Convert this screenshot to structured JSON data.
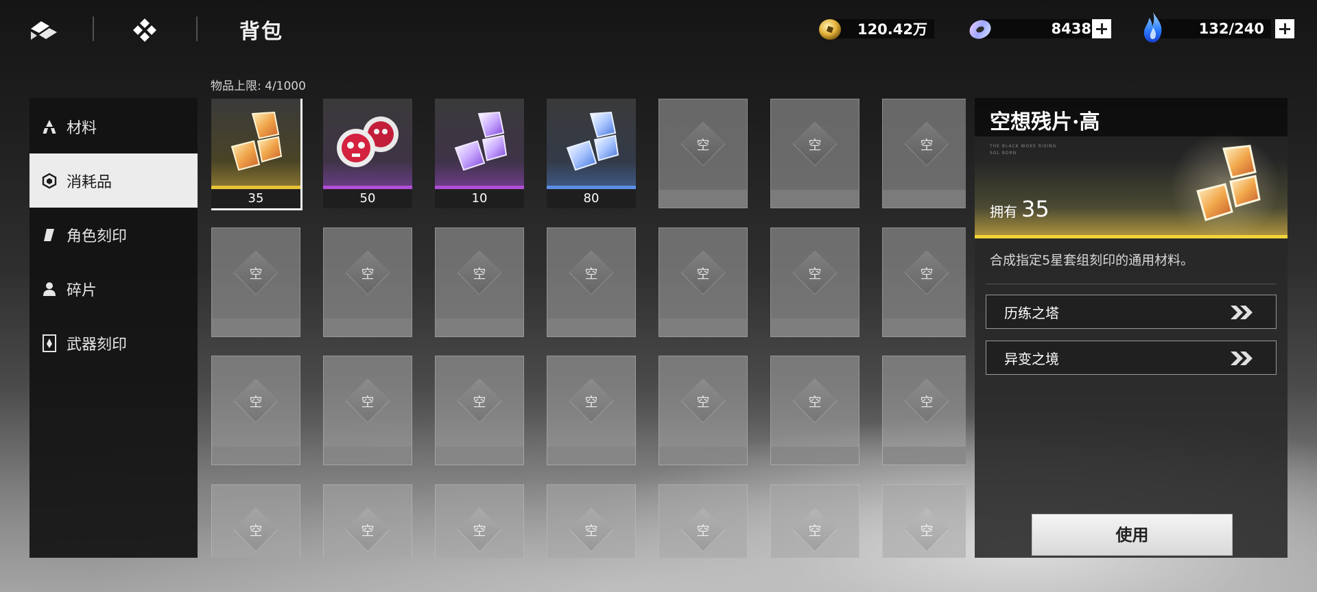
{
  "header": {
    "title": "背包",
    "back_icon": "back-chevron-icon",
    "home_icon": "home-diamond-icon"
  },
  "currencies": [
    {
      "name": "gold",
      "value": "120.42万",
      "icon": "gold-coin-icon",
      "has_plus": false
    },
    {
      "name": "crystal",
      "value": "8438",
      "icon": "crystal-ring-icon",
      "has_plus": true
    },
    {
      "name": "stamina",
      "value": "132/240",
      "icon": "blue-flame-icon",
      "has_plus": true
    }
  ],
  "sidebar": {
    "items": [
      {
        "label": "材料",
        "icon": "material-icon",
        "active": false
      },
      {
        "label": "消耗品",
        "icon": "consumable-icon",
        "active": true
      },
      {
        "label": "角色刻印",
        "icon": "character-imprint-icon",
        "active": false
      },
      {
        "label": "碎片",
        "icon": "fragment-person-icon",
        "active": false
      },
      {
        "label": "武器刻印",
        "icon": "weapon-imprint-icon",
        "active": false
      }
    ]
  },
  "inventory": {
    "capacity_label": "物品上限: 4/1000",
    "empty_label": "空",
    "items": [
      {
        "count": "35",
        "rarity_color": "#e8c33a",
        "art": "gold-fragment",
        "selected": true
      },
      {
        "count": "50",
        "rarity_color": "#b04ed6",
        "art": "red-skull-orbs",
        "selected": false
      },
      {
        "count": "10",
        "rarity_color": "#b04ed6",
        "art": "purple-fragment",
        "selected": false
      },
      {
        "count": "80",
        "rarity_color": "#5b8fe6",
        "art": "blue-fragment",
        "selected": false
      }
    ]
  },
  "detail": {
    "title": "空想残片·高",
    "tagline": "THE BLACK WOKE RISING\nSOL BORN",
    "own_label": "拥有",
    "own_value": "35",
    "description": "合成指定5星套组刻印的通用材料。",
    "sources": [
      "历练之塔",
      "异变之境"
    ],
    "use_button": "使用",
    "accent_color": "#f2d33a"
  }
}
